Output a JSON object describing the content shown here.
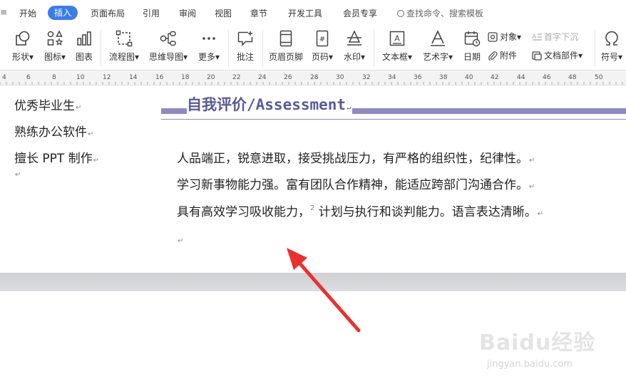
{
  "menu": {
    "edge": "≡",
    "tabs": [
      "开始",
      "插入",
      "页面布局",
      "引用",
      "审阅",
      "视图",
      "章节",
      "开发工具",
      "会员专享"
    ],
    "active_tab": "插入",
    "search_text": "查找命令、搜索模板"
  },
  "ribbon": {
    "shapes": "形状",
    "icons": "图标",
    "chart": "图表",
    "flowchart": "流程图",
    "mindmap": "思维导图",
    "more": "更多",
    "comment": "批注",
    "header_footer": "页眉页脚",
    "page_number": "页码",
    "watermark": "水印",
    "textbox": "文本框",
    "wordart": "艺术字",
    "date": "日期",
    "object": "对象",
    "attachment": "附件",
    "dropcap": "首字下沉",
    "doc_parts": "文档部件",
    "symbol": "符号"
  },
  "ruler": {
    "numbers": [
      "4",
      "6",
      "8",
      "10",
      "12",
      "14",
      "16",
      "18",
      "20",
      "22",
      "24",
      "26",
      "28",
      "30",
      "32",
      "34",
      "36",
      "38",
      "40",
      "42",
      "44",
      "46",
      "48",
      "50"
    ]
  },
  "document": {
    "skills": [
      "优秀毕业生",
      "熟练办公软件",
      "擅长 PPT 制作"
    ],
    "heading": "自我评价/Assessment",
    "paragraph_lines": [
      "人品端正，锐意进取，接受挑战压力，有严格的组织性，纪律性。",
      "学习新事物能力强。富有团队合作精神，能适应跨部门沟通合作。",
      "具有高效学习吸收能力，",
      "计划与执行和谈判能力。语言表达清晰。"
    ],
    "footnote_ref": "2",
    "para_mark": "↵"
  },
  "watermark": {
    "logo": "Baidu经验",
    "url": "jingyan.baidu.com"
  },
  "colors": {
    "accent": "#3a7de8",
    "heading": "#5a5a98",
    "heading_bar": "#8c8cc0",
    "arrow": "#e8312f"
  }
}
